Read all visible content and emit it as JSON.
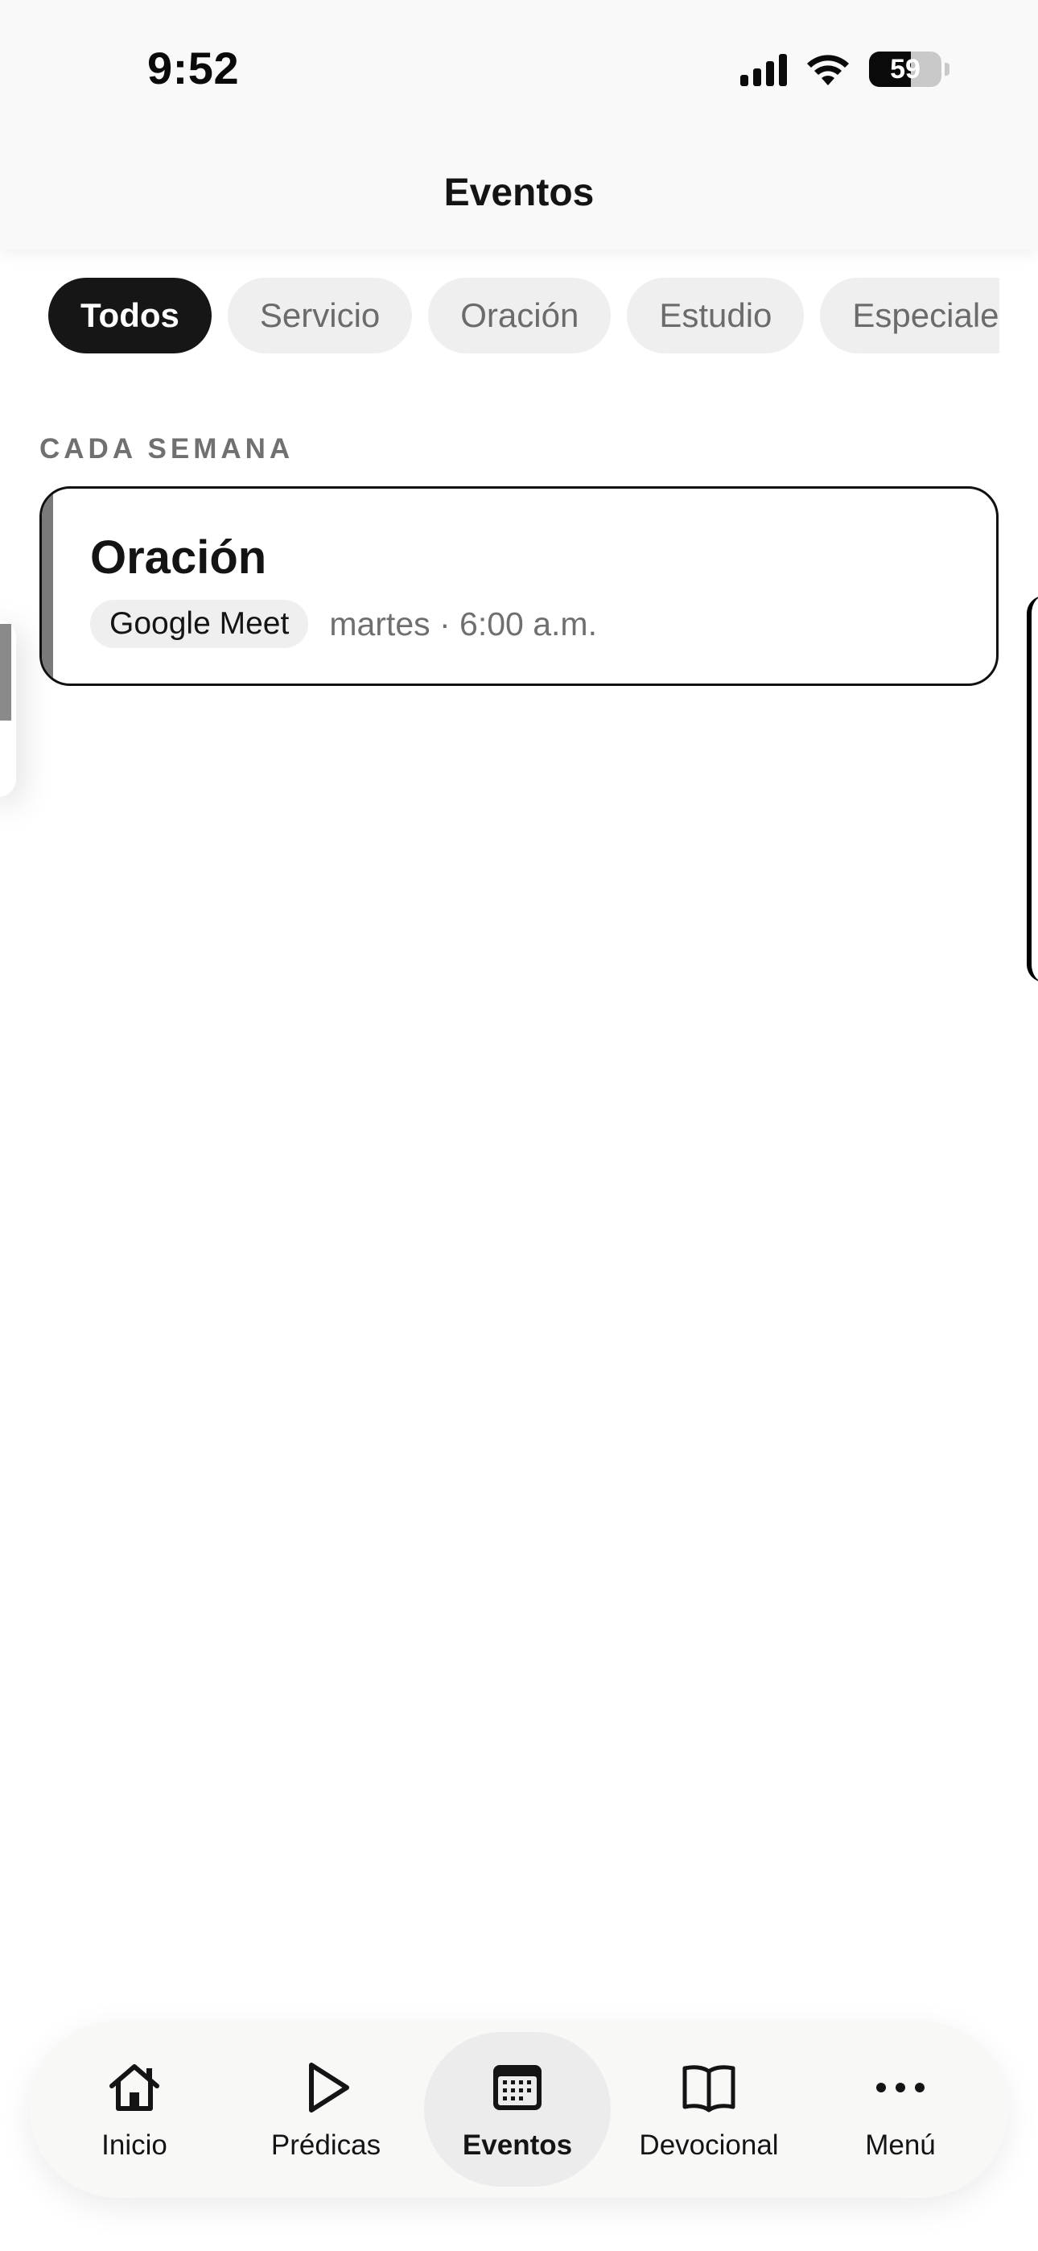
{
  "status_bar": {
    "time": "9:52",
    "battery_level": "59"
  },
  "header": {
    "title": "Eventos"
  },
  "filters": [
    {
      "label": "Todos",
      "active": true
    },
    {
      "label": "Servicio",
      "active": false
    },
    {
      "label": "Oración",
      "active": false
    },
    {
      "label": "Estudio",
      "active": false
    },
    {
      "label": "Especiales",
      "active": false
    }
  ],
  "section": {
    "label": "CADA SEMANA"
  },
  "event": {
    "title": "Oración",
    "platform": "Google Meet",
    "schedule": "martes · 6:00 a.m."
  },
  "tabbar": {
    "items": [
      {
        "label": "Inicio",
        "icon": "home-icon"
      },
      {
        "label": "Prédicas",
        "icon": "play-icon"
      },
      {
        "label": "Eventos",
        "icon": "calendar-icon",
        "active": true
      },
      {
        "label": "Devocional",
        "icon": "book-icon"
      },
      {
        "label": "Menú",
        "icon": "more-icon"
      }
    ]
  },
  "colors": {
    "accent_dark": "#161616",
    "chip_bg": "#efefef",
    "muted_text": "#707070"
  }
}
